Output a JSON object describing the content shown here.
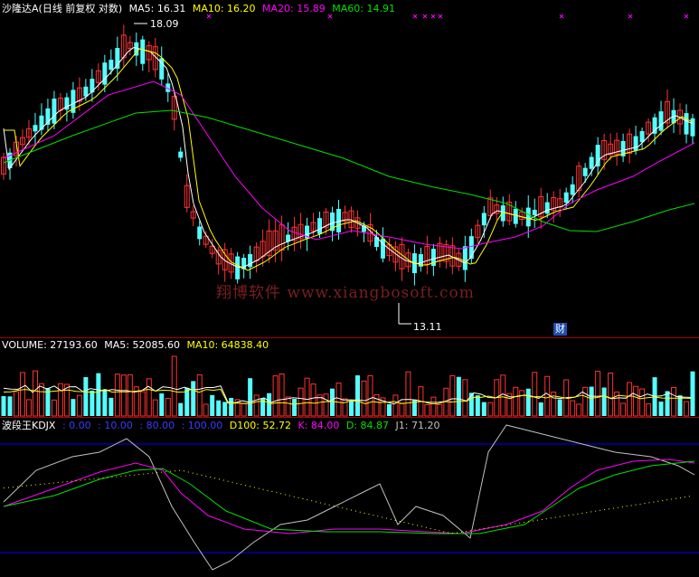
{
  "header": {
    "name": "沙隆达A",
    "mode": "(日线 前复权 对数)",
    "ma5": "MA5: 16.31",
    "ma10": "MA10: 16.20",
    "ma20": "MA20: 15.89",
    "ma60": "MA60: 14.91"
  },
  "volume_header": {
    "volume": "VOLUME: 27193.60",
    "ma5": "MA5: 52085.60",
    "ma10": "MA10: 64838.40"
  },
  "kdj_header": {
    "name": "波段王KDJX",
    "p1": ": 0.00",
    "p2": ": 10.00",
    "p3": ": 80.00",
    "p4": ": 100.00",
    "d100": "D100: 52.72",
    "k": "K: 84.00",
    "d": "D: 84.87",
    "j1": "J1: 71.20"
  },
  "labels": {
    "high": "18.09",
    "low": "13.11",
    "event": "财",
    "watermark": "翔博软件 www.xiangbosoft.com"
  },
  "colors": {
    "up": "#ff3333",
    "down": "#54ffff",
    "ma5": "#ffffff",
    "ma10": "#ffff00",
    "ma20": "#ff00ff",
    "ma60": "#00e000",
    "separator": "#b00000",
    "kdj_line": "#0000ff"
  },
  "chart_data": {
    "type": "candlestick",
    "price_scale": "log",
    "price_high": 18.09,
    "price_low": 13.11,
    "ma_last": {
      "MA5": 16.31,
      "MA10": 16.2,
      "MA20": 15.89,
      "MA60": 14.91
    },
    "volume_last": 27193.6,
    "volume_ma_last": {
      "MA5": 52085.6,
      "MA10": 64838.4
    },
    "kdj_last": {
      "D100": 52.72,
      "K": 84.0,
      "D": 84.87,
      "J1": 71.2
    },
    "kdj_levels": [
      0,
      10,
      80,
      100
    ]
  }
}
